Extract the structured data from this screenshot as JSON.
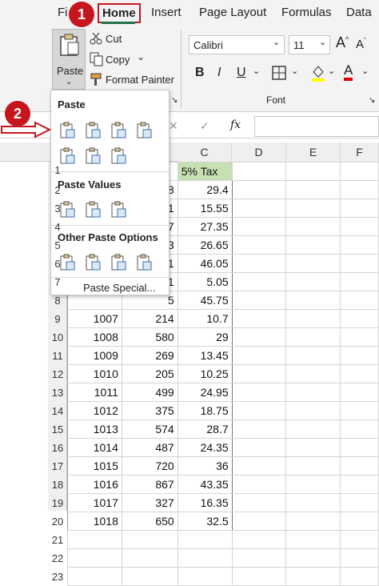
{
  "ribbon": {
    "tabs": [
      "Fi",
      "Home",
      "Insert",
      "Page Layout",
      "Formulas",
      "Data"
    ],
    "paste_label": "Paste",
    "cut_label": "Cut",
    "copy_label": "Copy",
    "format_painter_label": "Format Painter",
    "font_name": "Calibri",
    "font_size": "11",
    "font_group_label": "Font",
    "bold": "B",
    "italic": "I",
    "underline": "U"
  },
  "formula_bar": {
    "fx": "fx",
    "x": "✕",
    "check": "✓"
  },
  "paste_menu": {
    "heading_paste": "Paste",
    "heading_values": "Paste Values",
    "heading_other": "Other Paste Options",
    "paste_special": "Paste Special..."
  },
  "callouts": {
    "one": "1",
    "two": "2"
  },
  "columns": [
    "C",
    "D",
    "E",
    "F"
  ],
  "header_c": "5% Tax",
  "rows": [
    {
      "n": "2",
      "a": "",
      "b": "8",
      "c": "29.4"
    },
    {
      "n": "3",
      "a": "",
      "b": "1",
      "c": "15.55"
    },
    {
      "n": "4",
      "a": "",
      "b": "7",
      "c": "27.35"
    },
    {
      "n": "5",
      "a": "",
      "b": "3",
      "c": "26.65"
    },
    {
      "n": "6",
      "a": "",
      "b": "1",
      "c": "46.05"
    },
    {
      "n": "7",
      "a": "",
      "b": "1",
      "c": "5.05"
    },
    {
      "n": "8",
      "a": "",
      "b": "5",
      "c": "45.75"
    },
    {
      "n": "9",
      "a": "1007",
      "b": "214",
      "c": "10.7"
    },
    {
      "n": "10",
      "a": "1008",
      "b": "580",
      "c": "29"
    },
    {
      "n": "11",
      "a": "1009",
      "b": "269",
      "c": "13.45"
    },
    {
      "n": "12",
      "a": "1010",
      "b": "205",
      "c": "10.25"
    },
    {
      "n": "13",
      "a": "1011",
      "b": "499",
      "c": "24.95"
    },
    {
      "n": "14",
      "a": "1012",
      "b": "375",
      "c": "18.75"
    },
    {
      "n": "15",
      "a": "1013",
      "b": "574",
      "c": "28.7"
    },
    {
      "n": "16",
      "a": "1014",
      "b": "487",
      "c": "24.35"
    },
    {
      "n": "17",
      "a": "1015",
      "b": "720",
      "c": "36"
    },
    {
      "n": "18",
      "a": "1016",
      "b": "867",
      "c": "43.35"
    },
    {
      "n": "19",
      "a": "1017",
      "b": "327",
      "c": "16.35"
    },
    {
      "n": "20",
      "a": "1018",
      "b": "650",
      "c": "32.5"
    },
    {
      "n": "21",
      "a": "",
      "b": "",
      "c": ""
    },
    {
      "n": "22",
      "a": "",
      "b": "",
      "c": ""
    },
    {
      "n": "23",
      "a": "",
      "b": "",
      "c": ""
    }
  ],
  "colors": {
    "accent": "#217346",
    "callout": "#c5161d",
    "header_fill": "#c6e0b4"
  }
}
